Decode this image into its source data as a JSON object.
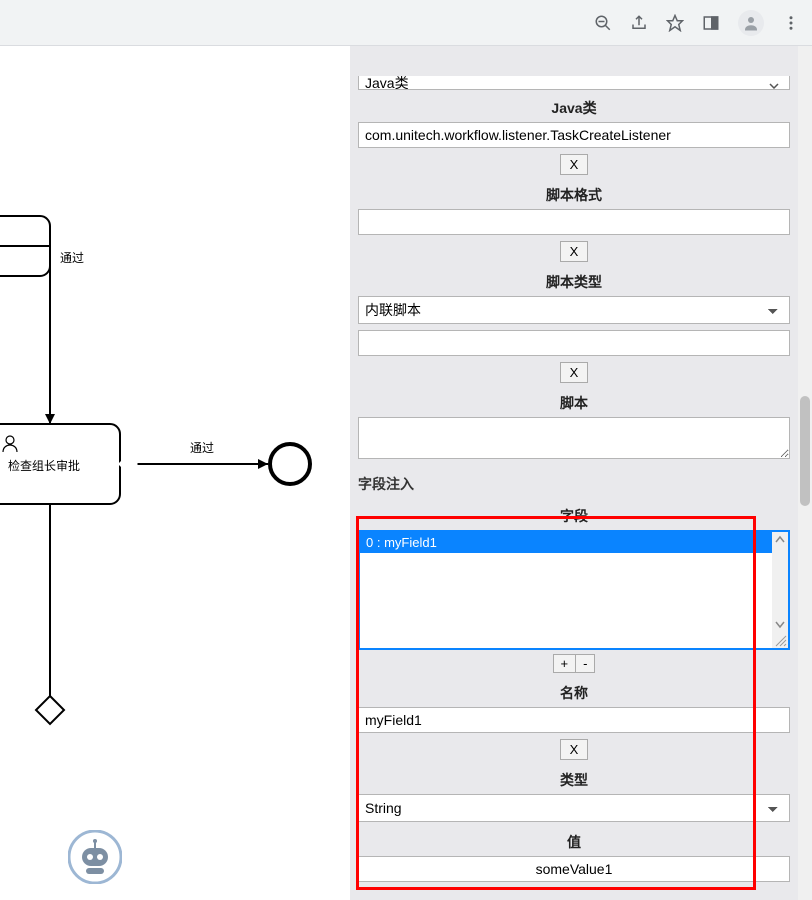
{
  "chrome": {
    "icons": {
      "zoom": "zoom-out-icon",
      "share": "share-icon",
      "star": "star-icon",
      "tab": "window-tab-icon",
      "avatar": "avatar-icon",
      "menu": "menu-dots-icon"
    }
  },
  "diagram": {
    "edge_label_1": "通过",
    "edge_label_2": "通过",
    "task_label": "检查组长审批"
  },
  "panel": {
    "top_select_value": "Java类",
    "java_class": {
      "label": "Java类",
      "value": "com.unitech.workflow.listener.TaskCreateListener",
      "x": "X"
    },
    "script_format": {
      "label": "脚本格式",
      "value": "",
      "x": "X"
    },
    "script_type": {
      "label": "脚本类型",
      "select_value": "内联脚本",
      "value": "",
      "x": "X"
    },
    "script": {
      "label": "脚本",
      "value": ""
    },
    "field_inject_title": "字段注入",
    "field": {
      "label": "字段",
      "list_row": "0 : myField1",
      "plus": "+",
      "minus": "-"
    },
    "name": {
      "label": "名称",
      "value": "myField1",
      "x": "X"
    },
    "type": {
      "label": "类型",
      "select_value": "String"
    },
    "value": {
      "label": "值",
      "value": "someValue1"
    }
  }
}
